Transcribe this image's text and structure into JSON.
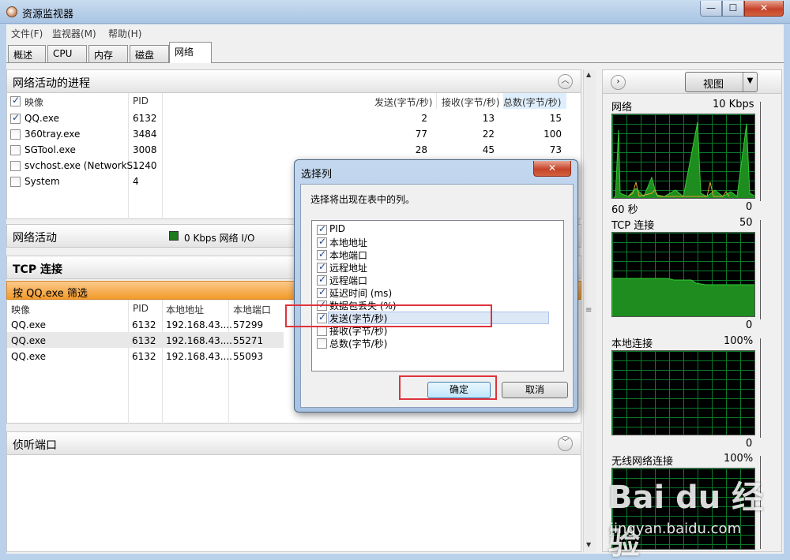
{
  "window": {
    "title": "资源监视器",
    "min": "—",
    "max": "☐",
    "close": "✕"
  },
  "menu": [
    "文件(F)",
    "监视器(M)",
    "帮助(H)"
  ],
  "tabs": [
    "概述",
    "CPU",
    "内存",
    "磁盘",
    "网络"
  ],
  "active_tab": "网络",
  "processes_panel": {
    "title": "网络活动的进程",
    "columns": {
      "image": "映像",
      "pid": "PID",
      "send": "发送(字节/秒)",
      "recv": "接收(字节/秒)",
      "total": "总数(字节/秒)"
    },
    "rows": [
      {
        "checked": true,
        "image": "QQ.exe",
        "pid": "6132",
        "send": "2",
        "recv": "13",
        "total": "15"
      },
      {
        "checked": false,
        "image": "360tray.exe",
        "pid": "3484",
        "send": "77",
        "recv": "22",
        "total": "100"
      },
      {
        "checked": false,
        "image": "SGTool.exe",
        "pid": "3008",
        "send": "28",
        "recv": "45",
        "total": "73"
      },
      {
        "checked": false,
        "image": "svchost.exe (NetworkS...",
        "pid": "1240",
        "send": "",
        "recv": "",
        "total": ""
      },
      {
        "checked": false,
        "image": "System",
        "pid": "4",
        "send": "",
        "recv": "",
        "total": ""
      }
    ]
  },
  "network_activity_panel": {
    "title": "网络活动",
    "status": "0 Kbps 网络 I/O",
    "indicator_color": "#1f7a1f"
  },
  "tcp_panel": {
    "title": "TCP 连接",
    "filter": "按 QQ.exe 筛选",
    "columns": {
      "image": "映像",
      "pid": "PID",
      "local_addr": "本地地址",
      "local_port": "本地端口"
    },
    "rows": [
      {
        "image": "QQ.exe",
        "pid": "6132",
        "local_addr": "192.168.43....",
        "local_port": "57299"
      },
      {
        "image": "QQ.exe",
        "pid": "6132",
        "local_addr": "192.168.43....",
        "local_port": "55271"
      },
      {
        "image": "QQ.exe",
        "pid": "6132",
        "local_addr": "192.168.43....",
        "local_port": "55093"
      }
    ]
  },
  "listening_panel": {
    "title": "侦听端口"
  },
  "right_panel": {
    "view_button": "视图",
    "graphs": [
      {
        "label": "网络",
        "max": "10 Kbps",
        "left_bottom": "60 秒",
        "min": "0"
      },
      {
        "label": "TCP 连接",
        "max": "50",
        "left_bottom": "",
        "min": "0"
      },
      {
        "label": "本地连接",
        "max": "100%",
        "left_bottom": "",
        "min": "0"
      },
      {
        "label": "无线网络连接",
        "max": "100%",
        "left_bottom": "",
        "min": ""
      }
    ]
  },
  "dialog": {
    "title": "选择列",
    "close": "✕",
    "prompt": "选择将出现在表中的列。",
    "columns": [
      {
        "label": "PID",
        "checked": true
      },
      {
        "label": "本地地址",
        "checked": true
      },
      {
        "label": "本地端口",
        "checked": true
      },
      {
        "label": "远程地址",
        "checked": true
      },
      {
        "label": "远程端口",
        "checked": true
      },
      {
        "label": "延迟时间 (ms)",
        "checked": true
      },
      {
        "label": "数据包丢失 (%)",
        "checked": true
      },
      {
        "label": "发送(字节/秒)",
        "checked": true,
        "selected": true
      },
      {
        "label": "接收(字节/秒)",
        "checked": false
      },
      {
        "label": "总数(字节/秒)",
        "checked": false
      }
    ],
    "ok": "确定",
    "cancel": "取消"
  },
  "watermark": {
    "logo": "Bai du 经验",
    "url": "jingyan.baidu.com"
  },
  "colors": {
    "graph_line": "#33cc33",
    "graph_fill": "#1e8c1e",
    "accent_orange": "#f39a2a",
    "highlight_red": "#e0333c"
  }
}
